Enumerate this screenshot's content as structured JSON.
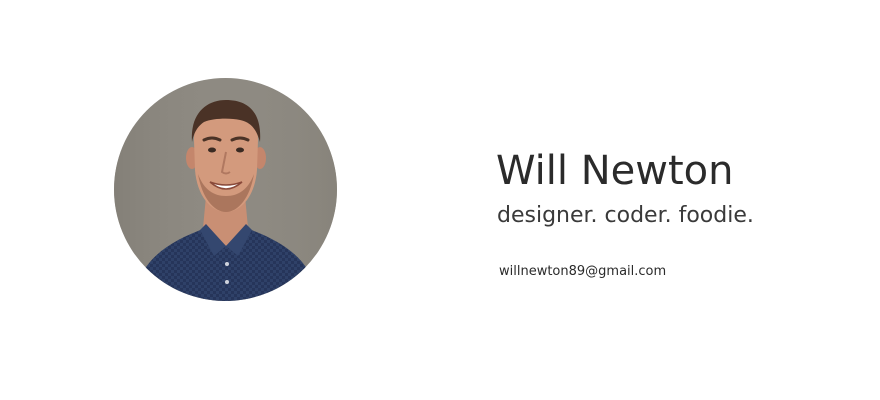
{
  "profile": {
    "name": "Will Newton",
    "tagline": "designer. coder. foodie.",
    "email": "willnewton89@gmail.com"
  },
  "colors": {
    "background": "#ffffff",
    "text": "#2b2b2b",
    "photo_background": "#8d8880",
    "shirt": "#2d3e63"
  },
  "icons": {
    "avatar": "profile-photo"
  }
}
